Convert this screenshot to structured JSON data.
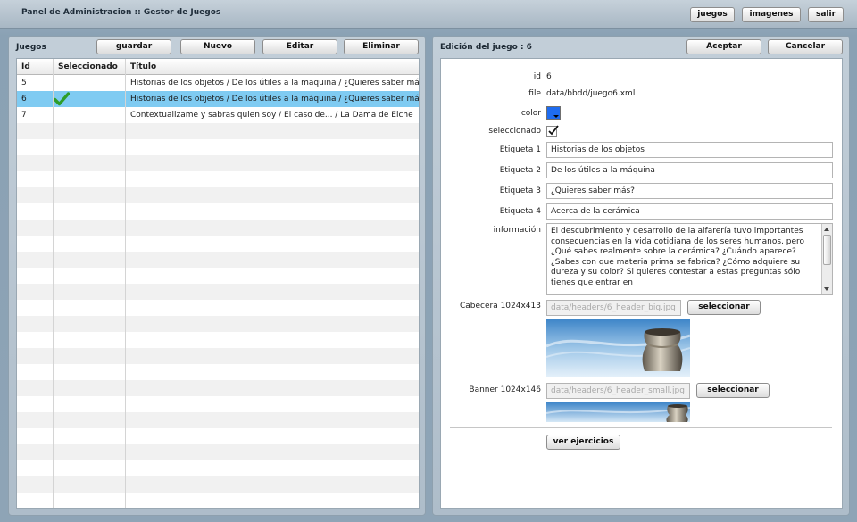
{
  "app": {
    "title": "Panel de Administracion :: Gestor de Juegos"
  },
  "top_nav": {
    "juegos": "juegos",
    "imagenes": "imagenes",
    "salir": "salir"
  },
  "left_panel": {
    "title": "Juegos",
    "buttons": {
      "guardar": "guardar",
      "nuevo": "Nuevo",
      "editar": "Editar",
      "eliminar": "Eliminar"
    },
    "columns": {
      "id": "Id",
      "selected": "Seleccionado",
      "title": "Título"
    },
    "rows": [
      {
        "id": "5",
        "selected": false,
        "title": "Historias de los objetos / De los útiles a la maquina / ¿Quieres saber más"
      },
      {
        "id": "6",
        "selected": true,
        "title": "Historias de los objetos / De los útiles a la máquina / ¿Quieres saber más"
      },
      {
        "id": "7",
        "selected": false,
        "title": "Contextualizame y sabras quien soy / El caso de... / La Dama de Elche"
      }
    ],
    "selected_row": "6"
  },
  "right_panel": {
    "title": "Edición del juego : 6",
    "buttons": {
      "accept": "Aceptar",
      "cancel": "Cancelar"
    },
    "labels": {
      "id": "id",
      "file": "file",
      "color": "color",
      "seleccionado": "seleccionado",
      "etiqueta1": "Etiqueta 1",
      "etiqueta2": "Etiqueta 2",
      "etiqueta3": "Etiqueta 3",
      "etiqueta4": "Etiqueta 4",
      "informacion": "información",
      "cabecera": "Cabecera 1024x413",
      "banner": "Banner 1024x146"
    },
    "values": {
      "id": "6",
      "file": "data/bbdd/juego6.xml",
      "color": "#1e6cf0",
      "seleccionado": true,
      "etiqueta1": "Historias de los objetos",
      "etiqueta2": "De los útiles a la máquina",
      "etiqueta3": "¿Quieres saber más?",
      "etiqueta4": "Acerca de la cerámica",
      "informacion": "El descubrimiento y desarrollo de la alfarería tuvo importantes consecuencias en la vida cotidiana de los seres humanos, pero ¿Qué sabes realmente sobre la cerámica? ¿Cuándo aparece? ¿Sabes con que materia prima se fabrica? ¿Cómo adquiere su dureza y su color? Si quieres contestar a estas preguntas sólo tienes que entrar en",
      "cabecera_path": "data/headers/6_header_big.jpg",
      "banner_path": "data/headers/6_header_small.jpg"
    },
    "select_label": "seleccionar",
    "ver_ejercicios": "ver ejercicios"
  },
  "icons": {
    "selected_check": "check-icon",
    "checkbox_mark": "checkmark-icon"
  }
}
